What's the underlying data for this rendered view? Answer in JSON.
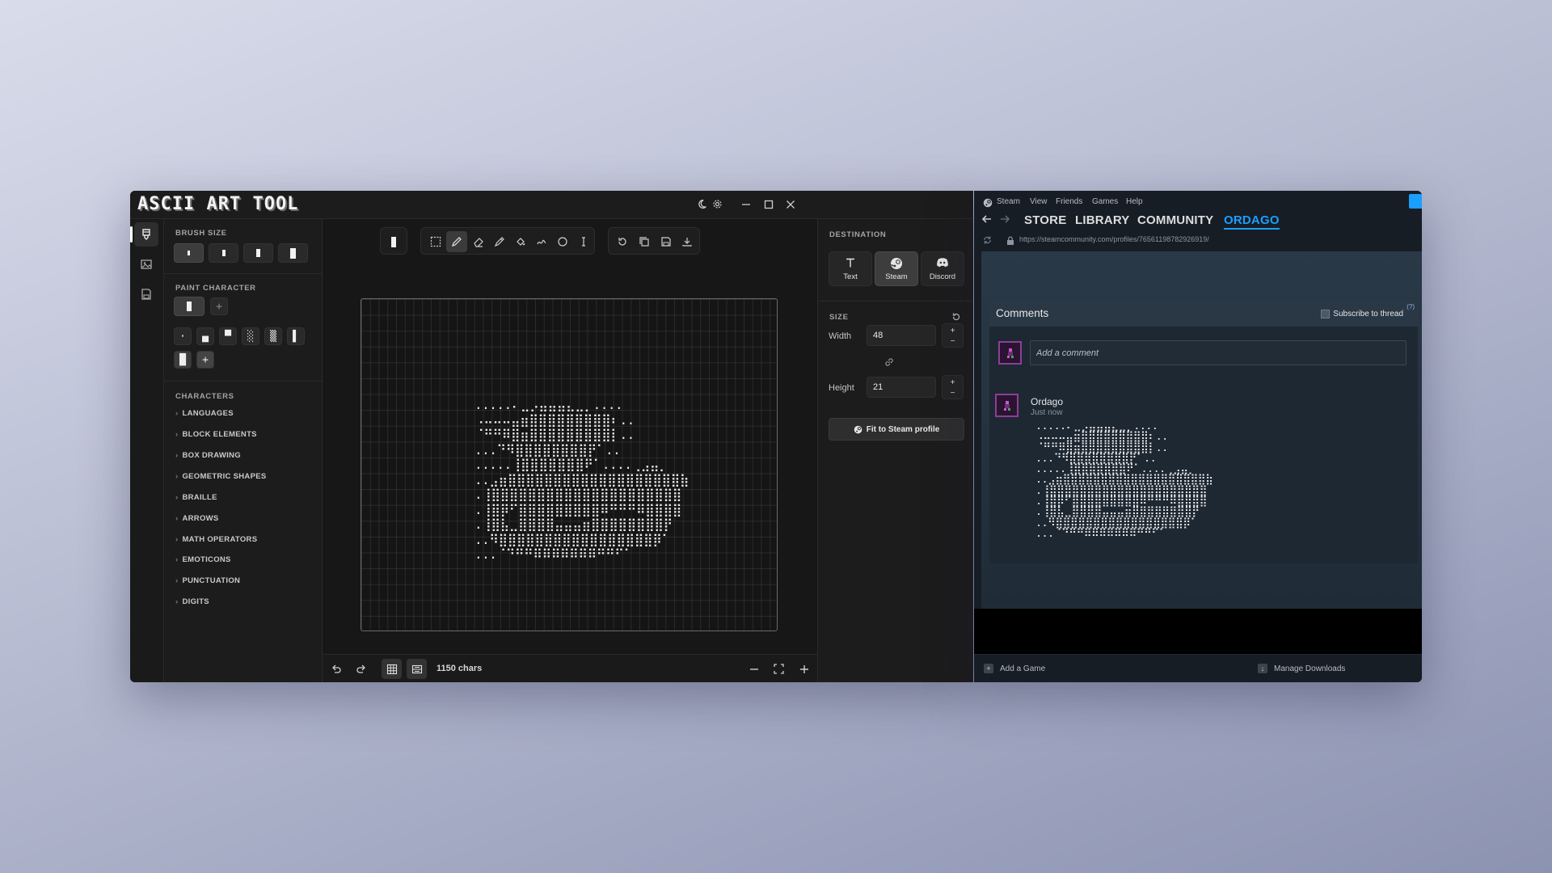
{
  "app": {
    "title": "ASCII ART TOOL",
    "brush_size": {
      "label": "BRUSH SIZE"
    },
    "paint_character": {
      "label": "PAINT CHARACTER",
      "current": "▌",
      "add": "+",
      "presets": [
        "·",
        "▄",
        "▀",
        "░",
        "▒",
        "▌",
        "█"
      ],
      "add2": "+"
    },
    "characters": {
      "label": "CHARACTERS",
      "items": [
        "LANGUAGES",
        "BLOCK ELEMENTS",
        "BOX DRAWING",
        "GEOMETRIC SHAPES",
        "BRAILLE",
        "ARROWS",
        "MATH OPERATORS",
        "EMOTICONS",
        "PUNCTUATION",
        "DIGITS"
      ]
    },
    "bottombar": {
      "chars_count": "1150 chars"
    },
    "destination": {
      "label": "DESTINATION",
      "options": [
        "Text",
        "Steam",
        "Discord"
      ],
      "selected": "Steam"
    },
    "size": {
      "label": "SIZE",
      "width_label": "Width",
      "width_value": "48",
      "height_label": "Height",
      "height_value": "21",
      "plus": "+",
      "minus": "−",
      "fit_button": "Fit to Steam profile"
    },
    "ascii_art": ".....⠄⣀⡠⣤⣤⣤⣄⣀⡀....\n⠠⠤⠤⠤⣤⣶⣿⣿⣿⣿⣿⣿⣿⣿⣿⠆..\n⠈⠛⠛⠿⣿⣶⣿⣿⣿⣿⣿⣿⣿⣿⣿⡇..\n...⠙⠻⣿⣿⣿⣿⣿⣿⣿⣿⡟⠁..\n.....⢸⣿⣿⣿⣿⣿⣿⣿⠟⠁....⢀⣠⣤⡀\n..⣠⣶⣿⣿⣿⣿⣿⣿⣿⣿⣿⣿⣿⣿⣿⣿⣿⣿⣿⣿⣿⣷\n.⢸⣿⣿⣿⣿⣿⣿⣿⣿⣿⣿⣿⣿⣿⣿⣿⣿⣿⣿⣿⣿⣿\n.⢸⣿⡿⠋⣿⣿⣿⣿⣿⣿⣿⣿⣿⠿⠛⠛⠛⠿⣿⣿⣿⣿\n.⢸⣿⣧⣀⣿⣿⣿⣿⣤⣤⣤⣶⣿⣿⣿⣿⣿⣿⣿⣿⡟\n..⠻⣿⣿⣿⣿⣿⣿⣿⣿⣿⣿⣿⣿⣿⣿⣿⣿⣿⡿⠁\n...⠈⠙⠛⠛⠿⠿⠿⠿⠿⠿⠿⠛⠛⠋⠁"
  },
  "steam": {
    "menu": [
      "Steam",
      "View",
      "Friends",
      "Games",
      "Help"
    ],
    "nav": [
      "STORE",
      "LIBRARY",
      "COMMUNITY",
      "ORDAGO"
    ],
    "active_nav": "ORDAGO",
    "url": "https://steamcommunity.com/profiles/76561198782926919/",
    "comments": {
      "title": "Comments",
      "subscribe": "Subscribe to thread",
      "help": "(?)",
      "placeholder": "Add a comment",
      "author": "Ordago",
      "time": "Just now"
    },
    "bottom": {
      "add_game": "Add a Game",
      "manage_downloads": "Manage Downloads"
    }
  }
}
